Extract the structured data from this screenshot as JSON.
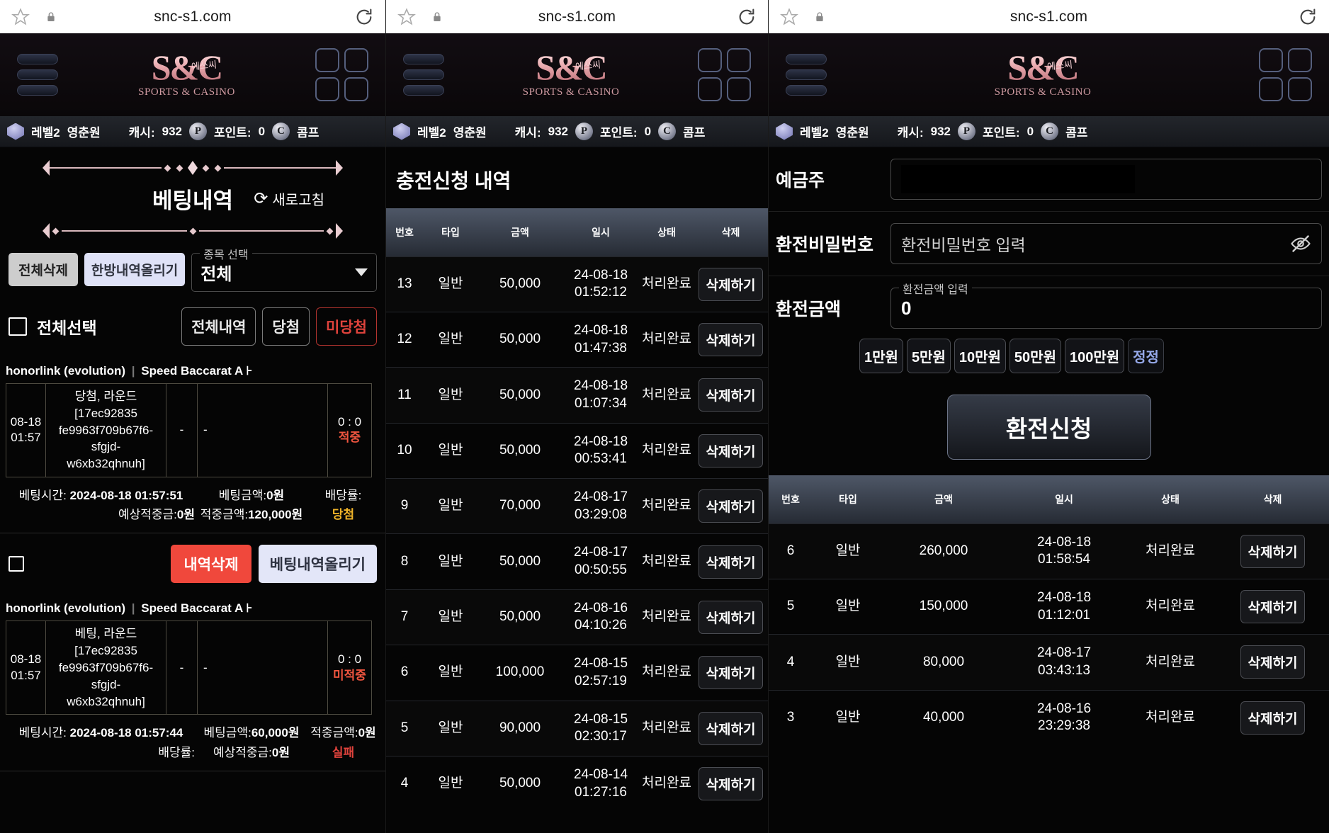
{
  "browser": {
    "url": "snc-s1.com",
    "star_icon": "star-icon",
    "lock_icon": "lock-icon",
    "reload_icon": "reload-icon"
  },
  "site": {
    "logo_mark": "S&C",
    "logo_kr": "에쓰씨",
    "logo_sub": "SPORTS & CASINO",
    "menu_icon": "hamburger-menu-icon",
    "grid_icon": "grid-menu-icon"
  },
  "userbar": {
    "level": "레벨2",
    "nickname": "영춘원",
    "cash_label": "캐시:",
    "cash_value": "932",
    "point_icon": "P",
    "point_label": "포인트:",
    "point_value": "0",
    "comp_icon": "C",
    "comp_label": "콤프"
  },
  "panel1": {
    "title": "베팅내역",
    "refresh_label": "새로고침",
    "refresh_icon": "refresh-icon",
    "delete_all": "전체삭제",
    "upload_one": "한방내역올리기",
    "select_legend": "종목 선택",
    "select_value": "전체",
    "select_all_label": "전체선택",
    "filters": [
      {
        "label": "전체내역",
        "style": "normal"
      },
      {
        "label": "당첨",
        "style": "normal"
      },
      {
        "label": "미당첨",
        "style": "red"
      }
    ],
    "cards": [
      {
        "provider": "honorlink (evolution)",
        "game": "Speed Baccarat A",
        "trail": "⊦",
        "time": "08-18\n01:57",
        "desc": "당첨, 라운드[17ec92835\nfe9963f709b67f6-sfgjd-\nw6xb32qhnuh]",
        "col3": "-",
        "col4": "-",
        "result_score": "0 : 0",
        "result_state": "적중",
        "bet_time_label": "베팅시간:",
        "bet_time": "2024-08-18 01:57:51",
        "bet_amount_label": "베팅금액:",
        "bet_amount": "0원",
        "odds_label": "배당률:",
        "odds": "",
        "expect_label": "예상적중금:",
        "expect": "0원",
        "hit_label": "적중금액:",
        "hit": "120,000원",
        "tag": "당첨",
        "tag_style": "win"
      },
      {
        "provider": "honorlink (evolution)",
        "game": "Speed Baccarat A",
        "trail": "⊦",
        "time": "08-18\n01:57",
        "desc": "베팅, 라운드[17ec92835\nfe9963f709b67f6-sfgjd-\nw6xb32qhnuh]",
        "col3": "-",
        "col4": "-",
        "result_score": "0 : 0",
        "result_state": "미적중",
        "bet_time_label": "베팅시간:",
        "bet_time": "2024-08-18 01:57:44",
        "bet_amount_label": "베팅금액:",
        "bet_amount": "60,000원",
        "odds_label": "배당률:",
        "odds": "",
        "expect_label": "예상적중금:",
        "expect": "0원",
        "hit_label": "적중금액:",
        "hit": "0원",
        "tag": "실패",
        "tag_style": "fail"
      }
    ],
    "row_delete": "내역삭제",
    "row_upload": "베팅내역올리기"
  },
  "panel2": {
    "title": "충전신청 내역",
    "columns": [
      "번호",
      "타입",
      "금액",
      "일시",
      "상태",
      "삭제"
    ],
    "delete_label": "삭제하기",
    "rows": [
      {
        "no": "13",
        "type": "일반",
        "amount": "50,000",
        "datetime": "24-08-18\n01:52:12",
        "status": "처리완료"
      },
      {
        "no": "12",
        "type": "일반",
        "amount": "50,000",
        "datetime": "24-08-18\n01:47:38",
        "status": "처리완료"
      },
      {
        "no": "11",
        "type": "일반",
        "amount": "50,000",
        "datetime": "24-08-18\n01:07:34",
        "status": "처리완료"
      },
      {
        "no": "10",
        "type": "일반",
        "amount": "50,000",
        "datetime": "24-08-18\n00:53:41",
        "status": "처리완료"
      },
      {
        "no": "9",
        "type": "일반",
        "amount": "70,000",
        "datetime": "24-08-17\n03:29:08",
        "status": "처리완료"
      },
      {
        "no": "8",
        "type": "일반",
        "amount": "50,000",
        "datetime": "24-08-17\n00:50:55",
        "status": "처리완료"
      },
      {
        "no": "7",
        "type": "일반",
        "amount": "50,000",
        "datetime": "24-08-16\n04:10:26",
        "status": "처리완료"
      },
      {
        "no": "6",
        "type": "일반",
        "amount": "100,000",
        "datetime": "24-08-15\n02:57:19",
        "status": "처리완료"
      },
      {
        "no": "5",
        "type": "일반",
        "amount": "90,000",
        "datetime": "24-08-15\n02:30:17",
        "status": "처리완료"
      },
      {
        "no": "4",
        "type": "일반",
        "amount": "50,000",
        "datetime": "24-08-14\n01:27:16",
        "status": "처리완료"
      }
    ]
  },
  "panel3": {
    "account_label": "예금주",
    "account_value": "",
    "password_label": "환전비밀번호",
    "password_placeholder": "환전비밀번호 입력",
    "eye_icon": "eye-off-icon",
    "amount_label": "환전금액",
    "amount_legend": "환전금액 입력",
    "amount_value": "0",
    "quick_amounts": [
      "1만원",
      "5만원",
      "10만원",
      "50만원",
      "100만원"
    ],
    "quick_fix": "정정",
    "submit_label": "환전신청",
    "columns": [
      "번호",
      "타입",
      "금액",
      "일시",
      "상태",
      "삭제"
    ],
    "delete_label": "삭제하기",
    "rows": [
      {
        "no": "6",
        "type": "일반",
        "amount": "260,000",
        "datetime": "24-08-18\n01:58:54",
        "status": "처리완료"
      },
      {
        "no": "5",
        "type": "일반",
        "amount": "150,000",
        "datetime": "24-08-18\n01:12:01",
        "status": "처리완료"
      },
      {
        "no": "4",
        "type": "일반",
        "amount": "80,000",
        "datetime": "24-08-17\n03:43:13",
        "status": "처리완료"
      },
      {
        "no": "3",
        "type": "일반",
        "amount": "40,000",
        "datetime": "24-08-16\n23:29:38",
        "status": "처리완료"
      }
    ]
  }
}
